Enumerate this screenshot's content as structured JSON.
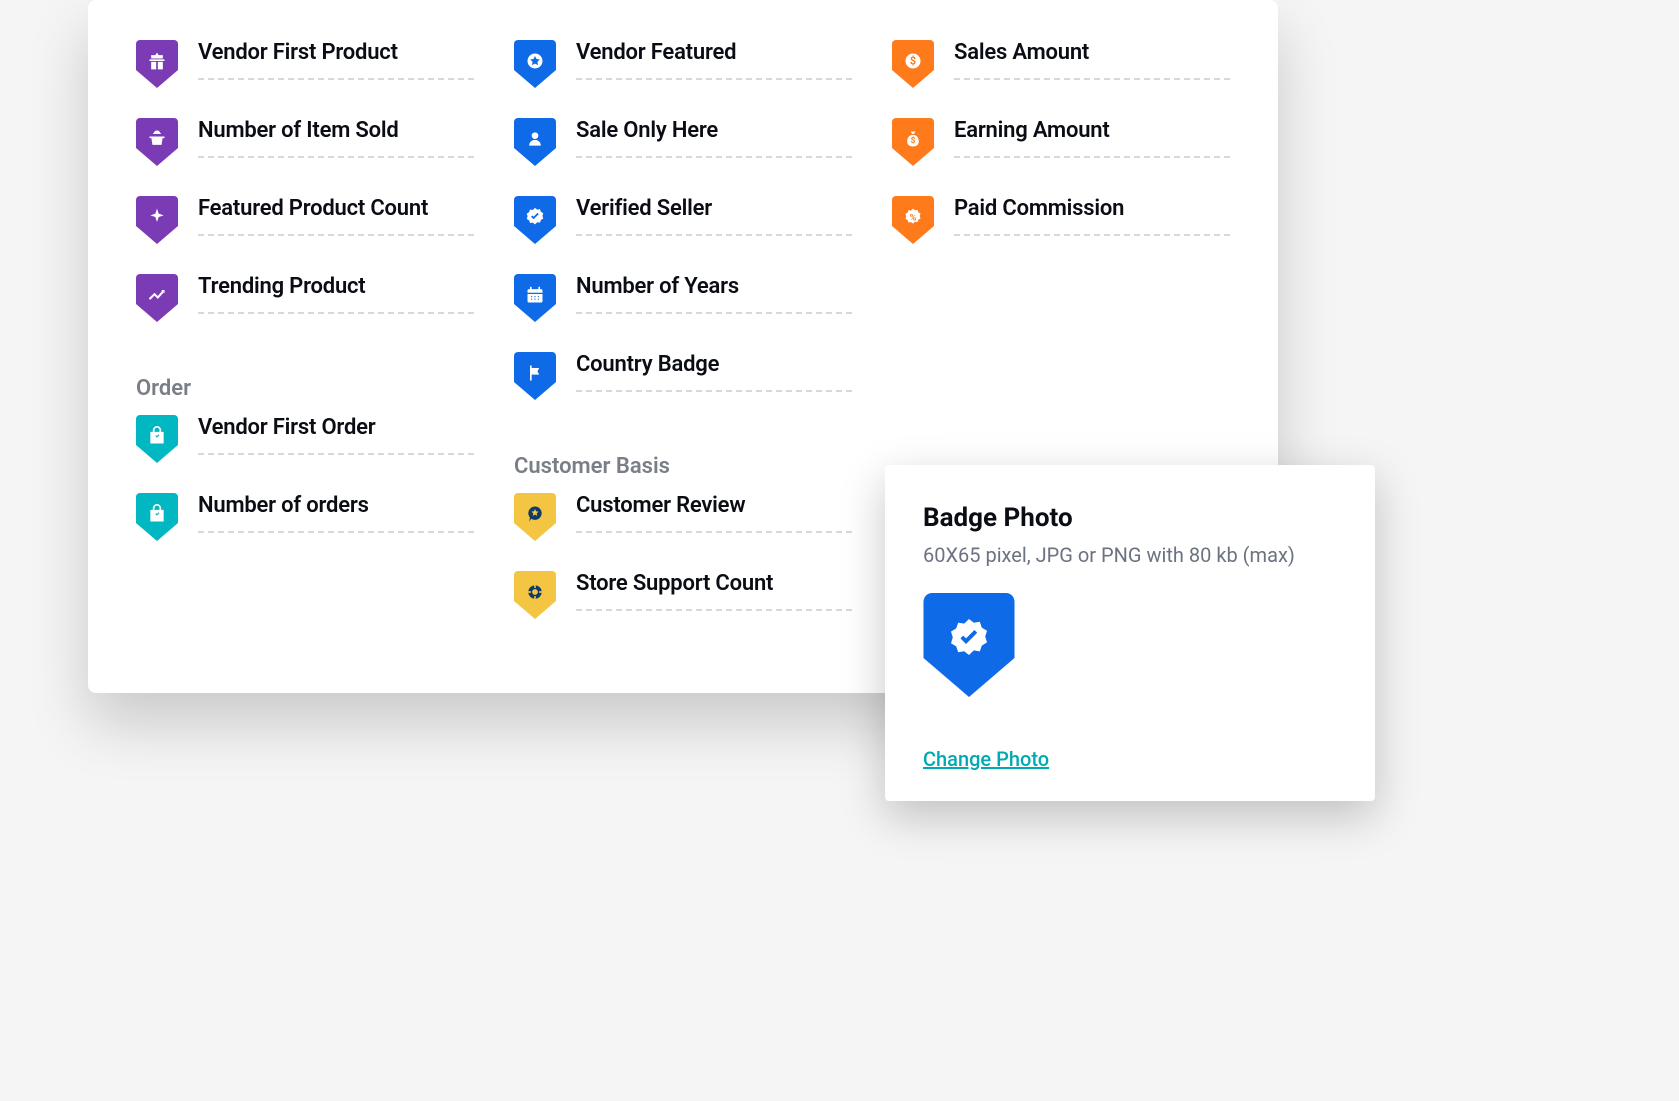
{
  "colors": {
    "purple": "#7b3bb5",
    "blue": "#0e6ae6",
    "orange": "#ff7a1a",
    "teal": "#00b7c2",
    "yellow": "#f4c542",
    "yellowDark": "#0f3a6b"
  },
  "columns": [
    {
      "sections": [
        {
          "title": null,
          "items": [
            {
              "label": "Vendor First Product",
              "color": "purple",
              "icon": "gift"
            },
            {
              "label": "Number of Item Sold",
              "color": "purple",
              "icon": "basket"
            },
            {
              "label": "Featured Product Count",
              "color": "purple",
              "icon": "sparkle"
            },
            {
              "label": "Trending Product",
              "color": "purple",
              "icon": "trend"
            }
          ]
        },
        {
          "title": "Order",
          "items": [
            {
              "label": "Vendor First Order",
              "color": "teal",
              "icon": "bag"
            },
            {
              "label": "Number of orders",
              "color": "teal",
              "icon": "bag"
            }
          ]
        }
      ]
    },
    {
      "sections": [
        {
          "title": null,
          "items": [
            {
              "label": "Vendor Featured",
              "color": "blue",
              "icon": "star"
            },
            {
              "label": "Sale Only Here",
              "color": "blue",
              "icon": "person"
            },
            {
              "label": "Verified Seller",
              "color": "blue",
              "icon": "verified"
            },
            {
              "label": "Number of Years",
              "color": "blue",
              "icon": "calendar"
            },
            {
              "label": "Country Badge",
              "color": "blue",
              "icon": "flag"
            }
          ]
        },
        {
          "title": "Customer Basis",
          "items": [
            {
              "label": "Customer Review",
              "color": "yellow",
              "icon": "review"
            },
            {
              "label": "Store Support Count",
              "color": "yellow",
              "icon": "support"
            }
          ]
        }
      ]
    },
    {
      "sections": [
        {
          "title": null,
          "items": [
            {
              "label": "Sales Amount",
              "color": "orange",
              "icon": "dollar"
            },
            {
              "label": "Earning Amount",
              "color": "orange",
              "icon": "moneybag"
            },
            {
              "label": "Paid Commission",
              "color": "orange",
              "icon": "percent"
            }
          ]
        }
      ]
    }
  ],
  "popup": {
    "title": "Badge Photo",
    "subtitle": "60X65 pixel, JPG or PNG with 80 kb (max)",
    "change_link": "Change Photo",
    "preview": {
      "color": "blue",
      "icon": "verified"
    }
  }
}
